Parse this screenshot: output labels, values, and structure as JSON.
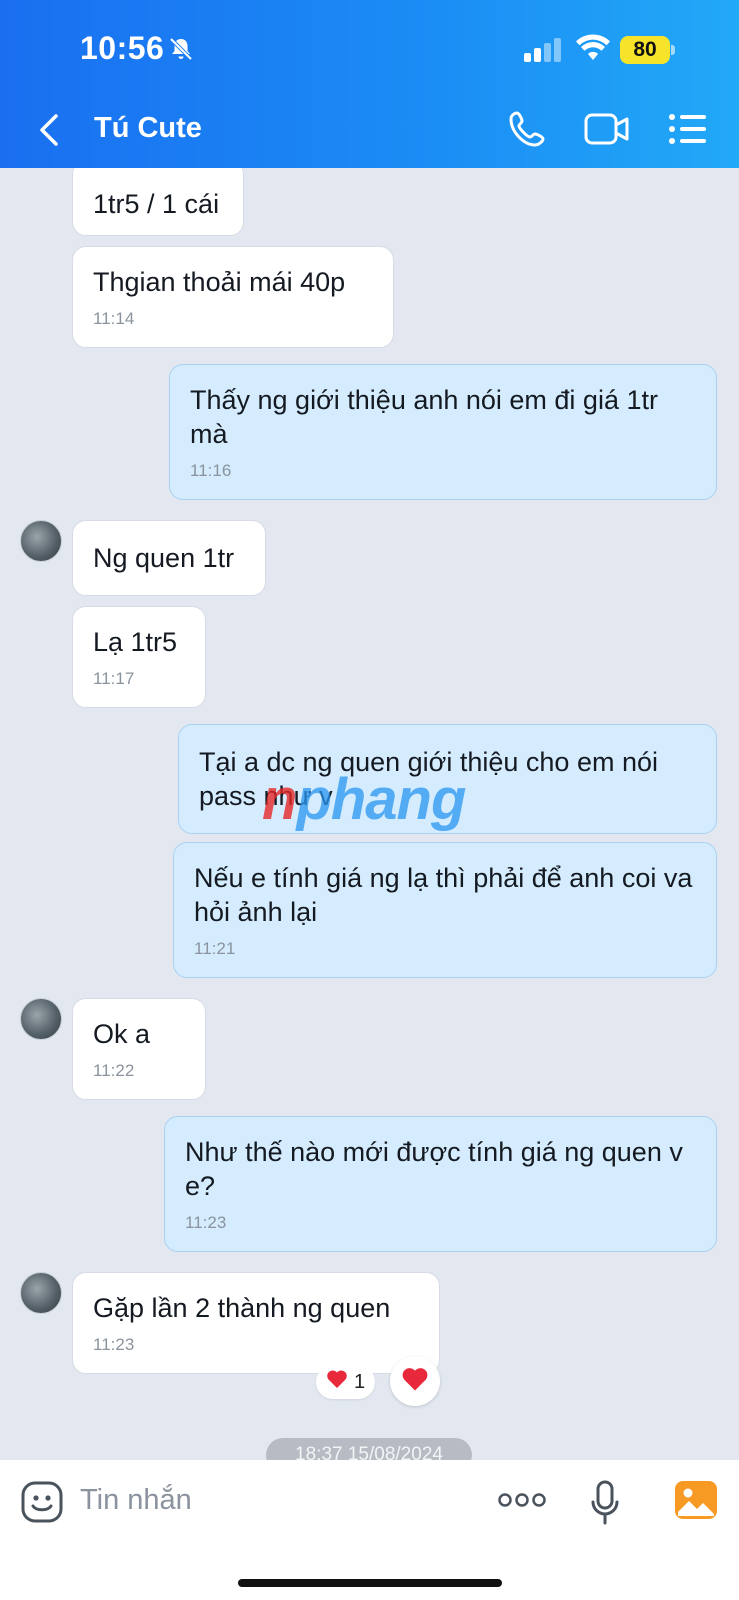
{
  "status_bar": {
    "time": "10:56",
    "battery": "80"
  },
  "header": {
    "contact_name": "Tú Cute"
  },
  "messages": [
    {
      "dir": "in",
      "text": "1tr5 / 1 cái",
      "time": ""
    },
    {
      "dir": "in",
      "text": "Thgian thoải mái 40p",
      "time": "11:14"
    },
    {
      "dir": "out",
      "text": "Thấy ng giới thiệu anh nói em đi giá 1tr mà",
      "time": "11:16"
    },
    {
      "dir": "in",
      "text": "Ng quen 1tr",
      "time": ""
    },
    {
      "dir": "in",
      "text": "Lạ 1tr5",
      "time": "11:17"
    },
    {
      "dir": "out",
      "text": "Tại a dc ng quen giới thiệu cho em nói pass như v",
      "time": ""
    },
    {
      "dir": "out",
      "text": "Nếu e tính giá ng lạ thì phải để anh coi va hỏi ảnh lại",
      "time": "11:21"
    },
    {
      "dir": "in",
      "text": "Ok a",
      "time": "11:22"
    },
    {
      "dir": "out",
      "text": "Như thế nào mới được tính giá ng quen v e?",
      "time": "11:23"
    },
    {
      "dir": "in",
      "text": "Gặp lần 2 thành ng quen",
      "time": "11:23"
    }
  ],
  "reaction": {
    "emoji": "heart",
    "count": "1"
  },
  "date_separator": "18:37 15/08/2024",
  "watermark": {
    "first": "n",
    "rest": "phang"
  },
  "composer": {
    "placeholder": "Tin nhắn"
  },
  "colors": {
    "header": "#1b8ef5",
    "outgoing_bubble": "#d4ecfd",
    "incoming_bubble": "#ffffff",
    "chat_background": "#e2e7f0"
  }
}
